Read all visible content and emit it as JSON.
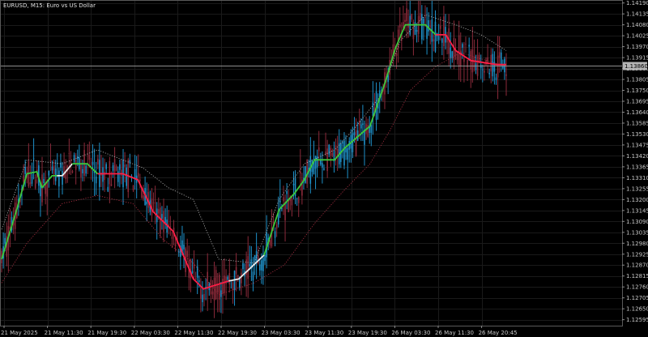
{
  "window": {
    "symbol_label": "EURUSD, M15:  Euro vs US Dollar",
    "current_price_label": "1.13860"
  },
  "colors": {
    "background": "#000000",
    "grid": "#1a1a1a",
    "candle_up": "#1e90c8",
    "candle_down": "#8b2a3a",
    "band_up": "#3cc83c",
    "band_down": "#ff1e46",
    "band_neutral": "#e8e8e8",
    "dotted_upper": "#b4b4b4",
    "dotted_lower": "#b43246",
    "current_line": "#8c8c8c",
    "axis_text": "#c8c8c8"
  },
  "chart_data": {
    "type": "candlestick",
    "title": "EURUSD, M15:  Euro vs US Dollar",
    "y_ticks": [
      "1.14190",
      "1.14135",
      "1.14080",
      "1.14025",
      "1.13970",
      "1.13915",
      "1.13860",
      "1.13805",
      "1.13750",
      "1.13695",
      "1.13640",
      "1.13585",
      "1.13530",
      "1.13475",
      "1.13420",
      "1.13365",
      "1.13310",
      "1.13255",
      "1.13200",
      "1.13145",
      "1.13090",
      "1.13035",
      "1.12980",
      "1.12925",
      "1.12870",
      "1.12815",
      "1.12760",
      "1.12705",
      "1.12650",
      "1.12595"
    ],
    "x_ticks": [
      "21 May 2025",
      "21 May 11:30",
      "21 May 19:30",
      "22 May 03:30",
      "22 May 11:30",
      "22 May 19:30",
      "23 May 03:30",
      "23 May 11:30",
      "23 May 19:30",
      "26 May 03:30",
      "26 May 11:30",
      "26 May 20:45"
    ],
    "ylim": [
      1.12565,
      1.14205
    ],
    "current_price": 1.13876,
    "grid": true,
    "trend_line": [
      {
        "t": 0.0,
        "y": 1.129
      },
      {
        "t": 0.03,
        "y": 1.1315
      },
      {
        "t": 0.05,
        "y": 1.1333
      },
      {
        "t": 0.07,
        "y": 1.1334
      },
      {
        "t": 0.08,
        "y": 1.1326
      },
      {
        "t": 0.1,
        "y": 1.1332
      },
      {
        "t": 0.12,
        "y": 1.1332
      },
      {
        "t": 0.14,
        "y": 1.1338
      },
      {
        "t": 0.17,
        "y": 1.1338
      },
      {
        "t": 0.19,
        "y": 1.1333
      },
      {
        "t": 0.24,
        "y": 1.1333
      },
      {
        "t": 0.27,
        "y": 1.133
      },
      {
        "t": 0.3,
        "y": 1.1314
      },
      {
        "t": 0.34,
        "y": 1.1304
      },
      {
        "t": 0.38,
        "y": 1.128
      },
      {
        "t": 0.4,
        "y": 1.1275
      },
      {
        "t": 0.45,
        "y": 1.1279
      },
      {
        "t": 0.47,
        "y": 1.128
      },
      {
        "t": 0.52,
        "y": 1.1292
      },
      {
        "t": 0.55,
        "y": 1.1315
      },
      {
        "t": 0.58,
        "y": 1.1323
      },
      {
        "t": 0.6,
        "y": 1.133
      },
      {
        "t": 0.62,
        "y": 1.134
      },
      {
        "t": 0.66,
        "y": 1.134
      },
      {
        "t": 0.68,
        "y": 1.1346
      },
      {
        "t": 0.73,
        "y": 1.1357
      },
      {
        "t": 0.76,
        "y": 1.1379
      },
      {
        "t": 0.78,
        "y": 1.1396
      },
      {
        "t": 0.8,
        "y": 1.1408
      },
      {
        "t": 0.84,
        "y": 1.1408
      },
      {
        "t": 0.86,
        "y": 1.1403
      },
      {
        "t": 0.88,
        "y": 1.1403
      },
      {
        "t": 0.9,
        "y": 1.1395
      },
      {
        "t": 0.93,
        "y": 1.139
      },
      {
        "t": 0.98,
        "y": 1.1388
      },
      {
        "t": 1.0,
        "y": 1.1388
      }
    ],
    "trend_segments": [
      {
        "from": 0.0,
        "to": 0.11,
        "state": "up"
      },
      {
        "from": 0.11,
        "to": 0.14,
        "state": "neutral"
      },
      {
        "from": 0.14,
        "to": 0.19,
        "state": "up"
      },
      {
        "from": 0.19,
        "to": 0.45,
        "state": "down"
      },
      {
        "from": 0.45,
        "to": 0.52,
        "state": "neutral"
      },
      {
        "from": 0.52,
        "to": 0.86,
        "state": "up"
      },
      {
        "from": 0.86,
        "to": 1.0,
        "state": "down"
      }
    ],
    "upper_band": [
      {
        "t": 0.0,
        "y": 1.1305
      },
      {
        "t": 0.05,
        "y": 1.134
      },
      {
        "t": 0.12,
        "y": 1.1338
      },
      {
        "t": 0.19,
        "y": 1.1345
      },
      {
        "t": 0.28,
        "y": 1.1336
      },
      {
        "t": 0.33,
        "y": 1.1326
      },
      {
        "t": 0.38,
        "y": 1.132
      },
      {
        "t": 0.43,
        "y": 1.129
      },
      {
        "t": 0.5,
        "y": 1.1288
      },
      {
        "t": 0.55,
        "y": 1.132
      },
      {
        "t": 0.6,
        "y": 1.1338
      },
      {
        "t": 0.66,
        "y": 1.1345
      },
      {
        "t": 0.7,
        "y": 1.1356
      },
      {
        "t": 0.75,
        "y": 1.1372
      },
      {
        "t": 0.79,
        "y": 1.14
      },
      {
        "t": 0.84,
        "y": 1.1413
      },
      {
        "t": 0.9,
        "y": 1.1408
      },
      {
        "t": 0.95,
        "y": 1.1403
      },
      {
        "t": 1.0,
        "y": 1.1395
      }
    ],
    "lower_band": [
      {
        "t": 0.0,
        "y": 1.1278
      },
      {
        "t": 0.05,
        "y": 1.1298
      },
      {
        "t": 0.12,
        "y": 1.1318
      },
      {
        "t": 0.19,
        "y": 1.1322
      },
      {
        "t": 0.26,
        "y": 1.1318
      },
      {
        "t": 0.32,
        "y": 1.13
      },
      {
        "t": 0.38,
        "y": 1.1288
      },
      {
        "t": 0.43,
        "y": 1.1272
      },
      {
        "t": 0.5,
        "y": 1.1278
      },
      {
        "t": 0.56,
        "y": 1.1287
      },
      {
        "t": 0.62,
        "y": 1.1308
      },
      {
        "t": 0.68,
        "y": 1.1325
      },
      {
        "t": 0.73,
        "y": 1.1338
      },
      {
        "t": 0.77,
        "y": 1.1355
      },
      {
        "t": 0.81,
        "y": 1.1375
      },
      {
        "t": 0.86,
        "y": 1.1387
      },
      {
        "t": 0.91,
        "y": 1.1394
      },
      {
        "t": 1.0,
        "y": 1.1387
      }
    ]
  }
}
